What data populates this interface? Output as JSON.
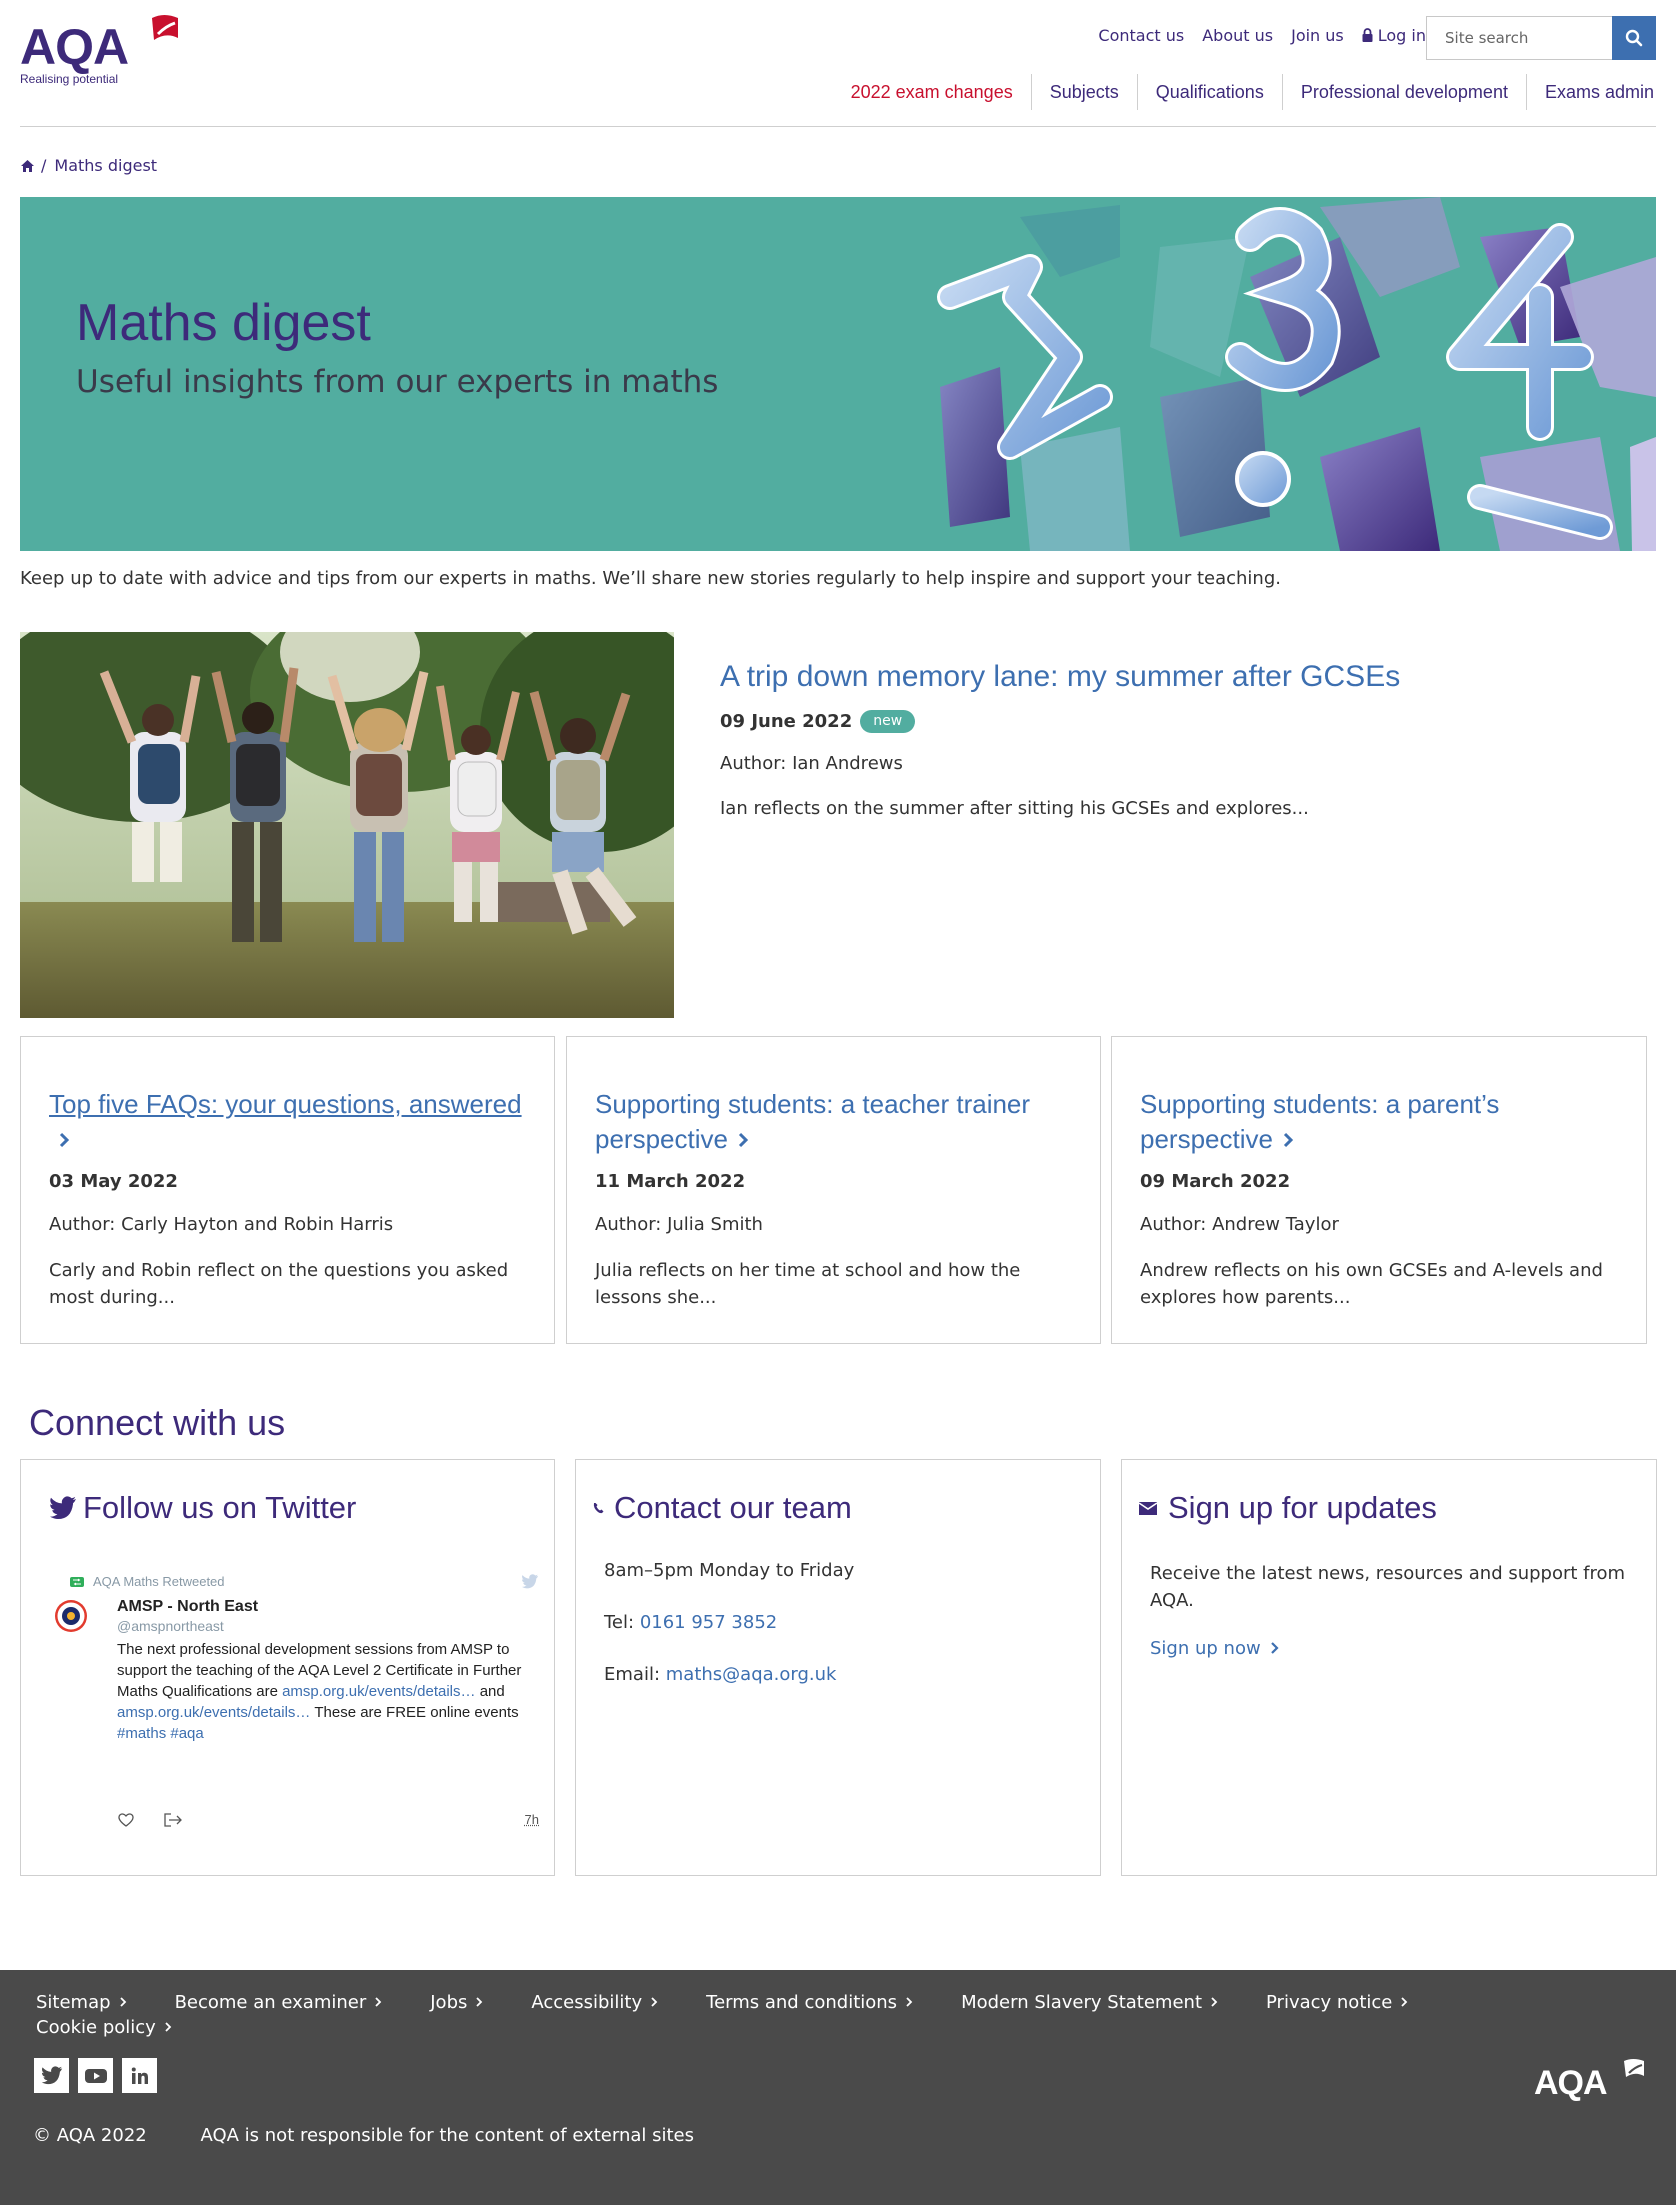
{
  "brand": {
    "logo_text": "AQA",
    "tagline": "Realising potential",
    "colors": {
      "purple": "#3d2a7a",
      "red": "#c8102e",
      "teal": "#52ada0",
      "link_blue": "#3d6fb0",
      "footer": "#4a4a4a"
    }
  },
  "header": {
    "utility_links": [
      "Contact us",
      "About us",
      "Join us"
    ],
    "login_label": "Log in",
    "search_placeholder": "Site search",
    "main_nav": [
      {
        "label": "2022 exam changes",
        "highlight": true
      },
      {
        "label": "Subjects"
      },
      {
        "label": "Qualifications"
      },
      {
        "label": "Professional development"
      },
      {
        "label": "Exams admin"
      }
    ]
  },
  "breadcrumb": {
    "current": "Maths digest"
  },
  "hero": {
    "title": "Maths digest",
    "subtitle": "Useful insights from our experts in maths"
  },
  "intro": "Keep up to date with advice and tips from our experts in maths. We’ll share new stories regularly to help inspire and support your teaching.",
  "featured": {
    "title": "A trip down memory lane: my summer after GCSEs",
    "date": "09 June 2022",
    "badge": "new",
    "author": "Author: Ian Andrews",
    "excerpt": "Ian reflects on the summer after sitting his GCSEs and explores..."
  },
  "cards": [
    {
      "title": "Top five FAQs: your questions, answered",
      "date": "03 May 2022",
      "author": "Author: Carly Hayton and Robin Harris",
      "excerpt": "Carly and Robin reflect on the questions you asked most during..."
    },
    {
      "title": "Supporting students: a teacher trainer perspective",
      "date": "11 March 2022",
      "author": "Author: Julia Smith",
      "excerpt": "Julia reflects on her time at school and how the lessons she..."
    },
    {
      "title": "Supporting students: a parent’s perspective",
      "date": "09 March 2022",
      "author": "Author: Andrew Taylor",
      "excerpt": "Andrew reflects on his own GCSEs and A-levels and explores how parents..."
    }
  ],
  "connect": {
    "title": "Connect with us",
    "twitter": {
      "heading": "Follow us on Twitter",
      "retweeted_by": "AQA Maths Retweeted",
      "name": "AMSP - North East",
      "handle": "@amspnortheast",
      "text_1": "The next professional development sessions from AMSP to support the teaching of the AQA Level 2 Certificate in Further Maths Qualifications are",
      "link_1": "amsp.org.uk/events/details…",
      "text_2": "and",
      "link_2": "amsp.org.uk/events/details…",
      "text_3": "These are FREE online events",
      "hashtag_1": "#maths",
      "hashtag_2": "#aqa",
      "time": "7h"
    },
    "contact": {
      "heading": "Contact our team",
      "hours": "8am–5pm Monday to Friday",
      "tel_label": "Tel:",
      "tel": "0161 957 3852",
      "email_label": "Email:",
      "email": "maths@aqa.org.uk"
    },
    "signup": {
      "heading": "Sign up for updates",
      "text": "Receive the latest news, resources and support from AQA.",
      "link": "Sign up now"
    }
  },
  "footer": {
    "links": [
      "Sitemap",
      "Become an examiner",
      "Jobs",
      "Accessibility",
      "Terms and conditions",
      "Modern Slavery Statement",
      "Privacy notice",
      "Cookie policy"
    ],
    "social": [
      "twitter-icon",
      "youtube-icon",
      "linkedin-icon"
    ],
    "copyright": "© AQA 2022",
    "disclaimer": "AQA is not responsible for the content of external sites",
    "logo_text": "AQA"
  }
}
